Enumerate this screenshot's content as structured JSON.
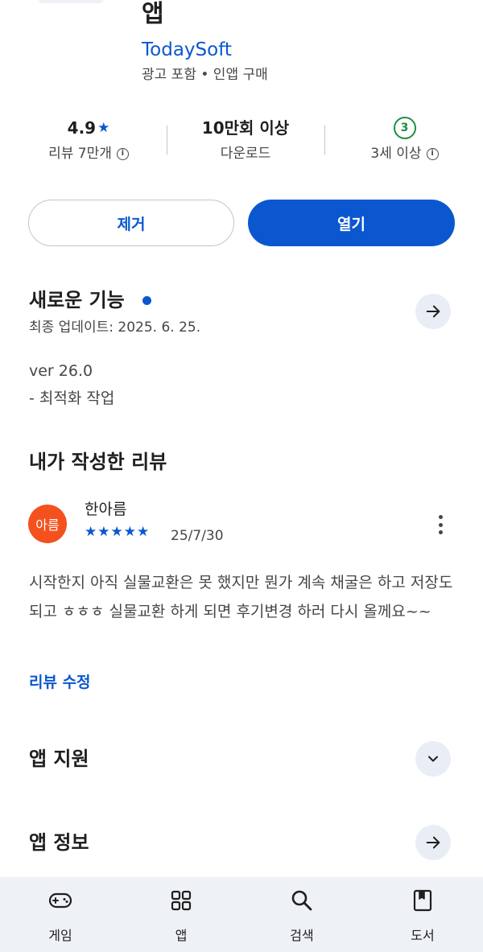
{
  "header": {
    "app_title": "앱",
    "developer": "TodaySoft",
    "ad_info": "광고 포함 • 인앱 구매"
  },
  "stats": {
    "rating": "4.9",
    "rating_star": "★",
    "reviews_label": "리뷰 7만개",
    "downloads": "10만회 이상",
    "downloads_label": "다운로드",
    "age_badge": "3",
    "age_label": "3세 이상",
    "info_glyph": "i"
  },
  "actions": {
    "remove_label": "제거",
    "open_label": "열기"
  },
  "whats_new": {
    "title": "새로운 기능",
    "updated": "최종 업데이트: 2025. 6. 25.",
    "version": "ver 26.0",
    "note": "- 최적화 작업"
  },
  "my_review": {
    "title": "내가 작성한 리뷰",
    "avatar_text": "아름",
    "reviewer": "한아름",
    "rating": 5,
    "date": "25/7/30",
    "body": "시작한지 아직 실물교환은 못 했지만 뭔가 계속 채굴은 하고 저장도 되고 ㅎㅎㅎ 실물교환 하게 되면 후기변경 하러 다시 올께요~~",
    "edit_label": "리뷰 수정"
  },
  "app_support": {
    "title": "앱 지원"
  },
  "app_info": {
    "title": "앱 정보"
  },
  "bottom_nav": {
    "items": [
      {
        "label": "게임",
        "icon": "gamepad-icon"
      },
      {
        "label": "앱",
        "icon": "apps-grid-icon"
      },
      {
        "label": "검색",
        "icon": "search-icon"
      },
      {
        "label": "도서",
        "icon": "book-icon"
      }
    ]
  },
  "colors": {
    "accent": "#0b57d0",
    "age_green": "#1e8e3e",
    "avatar_bg": "#f4511e",
    "nav_bg": "#eef1f6"
  }
}
